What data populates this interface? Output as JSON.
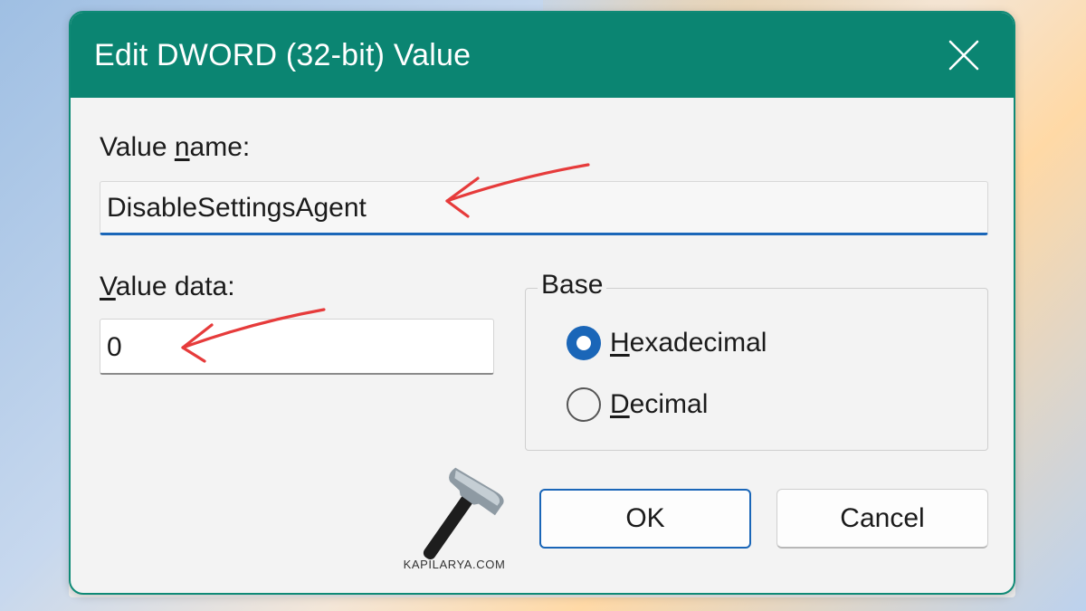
{
  "dialog": {
    "title": "Edit DWORD (32-bit) Value",
    "value_name_label": {
      "pre": "Value ",
      "u": "n",
      "post": "ame:"
    },
    "value_name": "DisableSettingsAgent",
    "value_data_label": {
      "pre": "",
      "u": "V",
      "post": "alue data:"
    },
    "value_data": "0",
    "base": {
      "legend": "Base",
      "options": [
        {
          "u": "H",
          "rest": "exadecimal",
          "checked": true
        },
        {
          "u": "D",
          "rest": "ecimal",
          "checked": false
        }
      ]
    },
    "ok_label": "OK",
    "cancel_label": "Cancel"
  },
  "watermark": {
    "text": "KAPILARYA.COM"
  },
  "colors": {
    "titlebar": "#0b8572",
    "accent": "#1a66b8",
    "annotation_arrow": "#e63b3b"
  },
  "icons": {
    "close": "close-icon",
    "annotation": "red-arrow-icon",
    "logo": "hammer-logo-icon"
  }
}
